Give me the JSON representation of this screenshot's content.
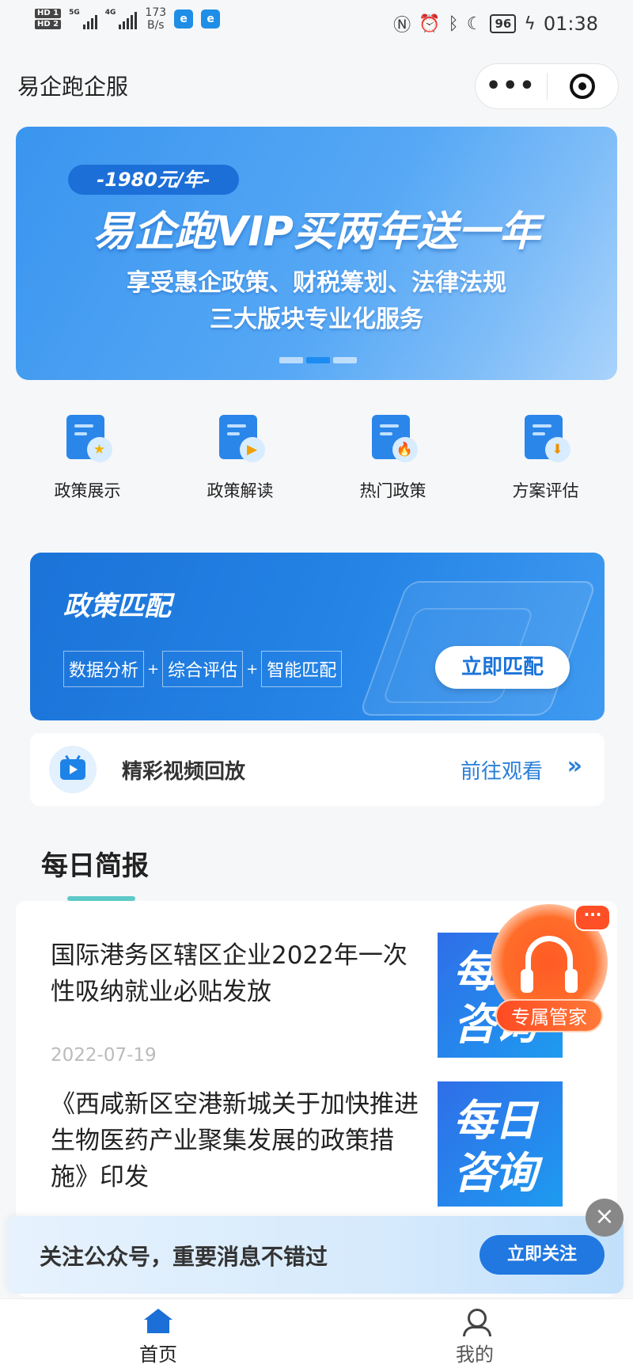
{
  "status_bar": {
    "hd1": "HD 1",
    "hd2": "HD 2",
    "sig1_type": "5G",
    "sig2_type": "4G",
    "speed_value": "173",
    "speed_unit": "B/s",
    "battery": "96",
    "time": "01:38"
  },
  "header": {
    "title": "易企跑企服"
  },
  "banner": {
    "price_tag": "-1980元/年-",
    "headline": "易企跑VIP买两年送一年",
    "subtitle_line1": "享受惠企政策、财税筹划、法律法规",
    "subtitle_line2": "三大版块专业化服务"
  },
  "shortcuts": [
    {
      "label": "政策展示",
      "icon": "policy-display-icon",
      "badge": "★"
    },
    {
      "label": "政策解读",
      "icon": "policy-interpret-icon",
      "badge": "▶"
    },
    {
      "label": "热门政策",
      "icon": "hot-policy-icon",
      "badge": "🔥"
    },
    {
      "label": "方案评估",
      "icon": "plan-evaluate-icon",
      "badge": "⬇"
    }
  ],
  "policy_match": {
    "title": "政策匹配",
    "tags": [
      "数据分析",
      "综合评估",
      "智能匹配"
    ],
    "plus": "+",
    "button": "立即匹配"
  },
  "video": {
    "title": "精彩视频回放",
    "link": "前往观看",
    "arrow": "»"
  },
  "daily_brief": {
    "title": "每日简报",
    "items": [
      {
        "title": "国际港务区辖区企业2022年一次性吸纳就业必贴发放",
        "date": "2022-07-19",
        "thumb_line1": "每日",
        "thumb_line2": "咨询"
      },
      {
        "title": "《西咸新区空港新城关于加快推进生物医药产业聚集发展的政策措施》印发",
        "date": "",
        "thumb_line1": "每日",
        "thumb_line2": "咨询"
      }
    ]
  },
  "manager": {
    "label": "专属管家",
    "chat_dots": "···"
  },
  "follow_bar": {
    "text": "关注公众号，重要消息不错过",
    "button": "立即关注",
    "close": "×"
  },
  "tabbar": {
    "home": "首页",
    "mine": "我的"
  },
  "colors": {
    "primary": "#1b73d8",
    "accent_orange": "#ff5a24",
    "teal_underline": "#5ec9c7"
  }
}
